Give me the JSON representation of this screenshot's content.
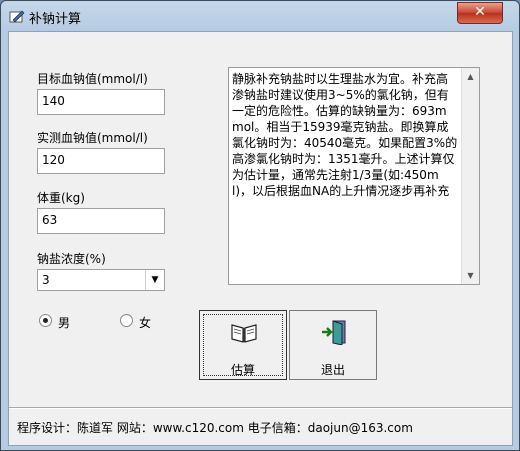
{
  "window": {
    "title": "补钠计算",
    "close_symbol": "✕"
  },
  "form": {
    "target_label": "目标血钠值(mmol/l)",
    "target_value": "140",
    "measured_label": "实测血钠值(mmol/l)",
    "measured_value": "120",
    "weight_label": "体重(kg)",
    "weight_value": "63",
    "concentration_label": "钠盐浓度(%)",
    "concentration_value": "3",
    "sex_male": "男",
    "sex_female": "女",
    "sex_selected": "male"
  },
  "result_text": "静脉补充钠盐时以生理盐水为宜。补充高渗钠盐时建议使用3~5%的氯化钠，但有一定的危险性。估算的缺钠量为：693mmol。相当于15939毫克钠盐。即换算成氯化钠时为：40540毫克。如果配置3%的高渗氯化钠时为：1351毫升。上述计算仅为估计量，通常先注射1/3量(如:450ml)，以后根据血NA的上升情况逐步再补充",
  "buttons": {
    "estimate": "估算",
    "exit": "退出"
  },
  "footer": "程序设计：陈道军  网站：www.c120.com  电子信箱：daojun@163.com",
  "icons": {
    "app": "pencil-paper-icon",
    "estimate": "open-book-icon",
    "exit": "exit-door-icon"
  }
}
